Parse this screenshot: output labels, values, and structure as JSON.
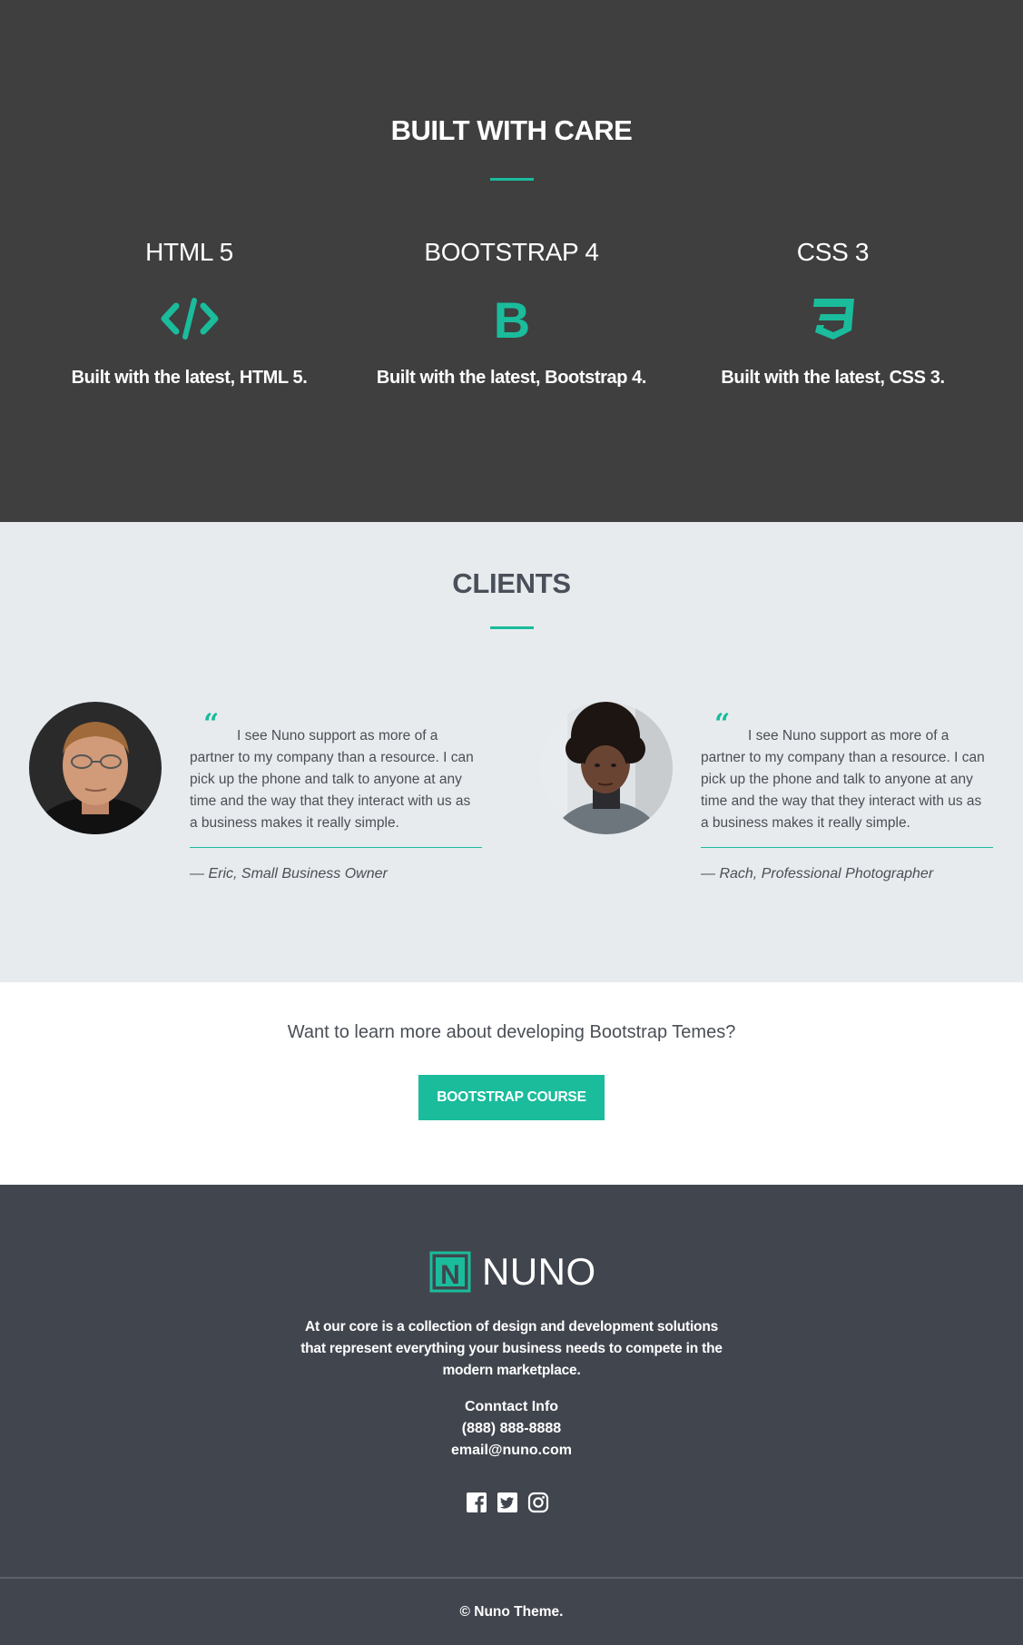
{
  "built": {
    "title": "BUILT WITH CARE",
    "features": [
      {
        "title": "HTML 5",
        "icon": "code-icon",
        "text": "Built with the latest, HTML 5."
      },
      {
        "title": "BOOTSTRAP 4",
        "icon": "bootstrap-icon",
        "text": "Built with the latest, Bootstrap 4."
      },
      {
        "title": "CSS 3",
        "icon": "css3-icon",
        "text": "Built with the latest, CSS 3."
      }
    ]
  },
  "clients": {
    "title": "CLIENTS",
    "testimonials": [
      {
        "quote": "I see Nuno support as more of a partner to my company than a resource. I can pick up the phone and talk to anyone at any time and the way that they interact with us as a business makes it really simple.",
        "author": "— Eric, Small Business Owner"
      },
      {
        "quote": "I see Nuno support as more of a partner to my company than a resource. I can pick up the phone and talk to anyone at any time and the way that they interact with us as a business makes it really simple.",
        "author": "— Rach, Professional Photographer"
      }
    ]
  },
  "cta": {
    "text": "Want to learn more about developing Bootstrap Temes?",
    "button_label": "BOOTSTRAP COURSE"
  },
  "footer": {
    "logo_text": "NUNO",
    "logo_mark": "N",
    "about": "At our core is a collection of design and development solutions that represent everything your business needs to compete in the modern marketplace.",
    "contact_heading": "Conntact Info",
    "phone": "(888) 888-8888",
    "email": "email@nuno.com",
    "socials": [
      "facebook-icon",
      "twitter-icon",
      "instagram-icon"
    ],
    "copyright": "© Nuno Theme."
  },
  "colors": {
    "accent": "#1abc9c",
    "built_bg": "#3f3f3f",
    "clients_bg": "#e8ebee",
    "footer_bg": "#41454e"
  }
}
